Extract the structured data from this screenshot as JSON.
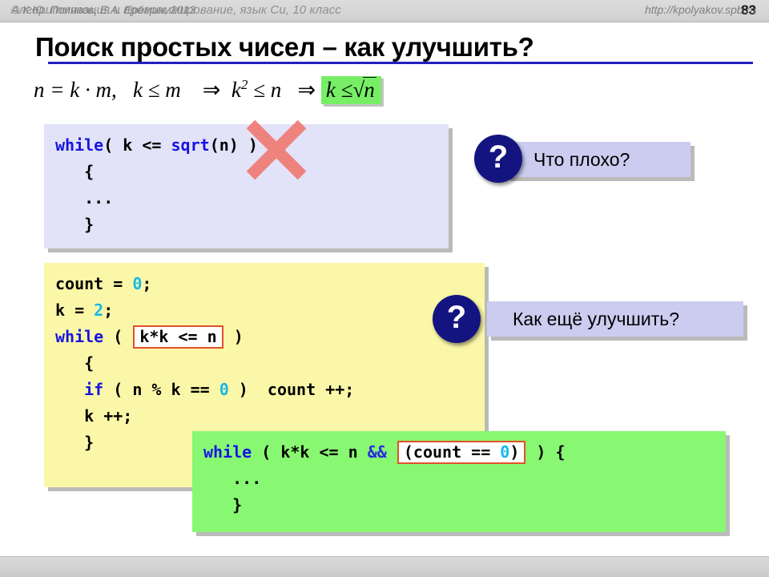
{
  "header": {
    "course_title": "Алгоритмизация и программирование, язык Си, 10 класс",
    "slide_number": "83"
  },
  "slide": {
    "title": "Поиск простых чисел – как улучшить?"
  },
  "formula": {
    "lhs": "n = k · m,",
    "cond": "k ≤ m",
    "arrow1": "⇒",
    "mid": "k",
    "mid_sup": "2",
    "mid_rel": "≤ n",
    "arrow2": "⇒",
    "highlight_left": "k ≤",
    "highlight_radical": "√",
    "highlight_radicand": "n",
    "highlight_color": "#77ee66"
  },
  "code_block_1": {
    "background": "#e2e2f8",
    "lines": [
      {
        "parts": [
          {
            "t": "while",
            "c": "kw"
          },
          {
            "t": "( k <= ",
            "c": ""
          },
          {
            "t": "sqrt",
            "c": "kw"
          },
          {
            "t": "(n) )",
            "c": ""
          }
        ]
      },
      {
        "parts": [
          {
            "t": "   {",
            "c": ""
          }
        ]
      },
      {
        "parts": [
          {
            "t": "   ...",
            "c": ""
          }
        ]
      },
      {
        "parts": [
          {
            "t": "   }",
            "c": ""
          }
        ]
      }
    ],
    "crossed_out": true,
    "cross_color": "#f07a72"
  },
  "code_block_2": {
    "background": "#fbf7a8",
    "lines": [
      {
        "parts": [
          {
            "t": "count = ",
            "c": ""
          },
          {
            "t": "0",
            "c": "num"
          },
          {
            "t": ";",
            "c": ""
          }
        ]
      },
      {
        "parts": [
          {
            "t": "k = ",
            "c": ""
          },
          {
            "t": "2",
            "c": "num"
          },
          {
            "t": ";",
            "c": ""
          }
        ]
      },
      {
        "parts": [
          {
            "t": "while",
            "c": "kw"
          },
          {
            "t": " ( ",
            "c": ""
          },
          {
            "t": "k*k <= n",
            "c": "boxed"
          },
          {
            "t": " )",
            "c": ""
          }
        ]
      },
      {
        "parts": [
          {
            "t": "   {",
            "c": ""
          }
        ]
      },
      {
        "parts": [
          {
            "t": "   ",
            "c": ""
          },
          {
            "t": "if",
            "c": "kw"
          },
          {
            "t": " ( n % k == ",
            "c": ""
          },
          {
            "t": "0",
            "c": "num"
          },
          {
            "t": " )  count ++;",
            "c": ""
          }
        ]
      },
      {
        "parts": [
          {
            "t": "   k ++;",
            "c": ""
          }
        ]
      },
      {
        "parts": [
          {
            "t": "   }",
            "c": ""
          }
        ]
      }
    ]
  },
  "code_block_3": {
    "background": "#88f772",
    "lines": [
      {
        "parts": [
          {
            "t": "while",
            "c": "kw"
          },
          {
            "t": " ( k*k <= n ",
            "c": ""
          },
          {
            "t": "&&",
            "c": "op2"
          },
          {
            "t": " ",
            "c": ""
          },
          {
            "t": "(count == 0)",
            "c": "boxed-num"
          },
          {
            "t": " ) {",
            "c": ""
          }
        ]
      },
      {
        "parts": [
          {
            "t": "   ...",
            "c": ""
          }
        ]
      },
      {
        "parts": [
          {
            "t": "   }",
            "c": ""
          }
        ]
      }
    ]
  },
  "callouts": [
    {
      "badge": "?",
      "text": "Что плохо?"
    },
    {
      "badge": "?",
      "text": "Как ещё улучшить?"
    }
  ],
  "footer": {
    "copyright": "© К.Ю. Поляков, Е.А. Ерёмин, 2013",
    "url": "http://kpolyakov.spb.ru"
  },
  "colors": {
    "title_rule": "#2222bb",
    "keyword": "#1515e0",
    "number": "#17b9e8",
    "box_border": "#e2502a",
    "badge": "#141480",
    "callout_bg": "#ccccf0"
  }
}
